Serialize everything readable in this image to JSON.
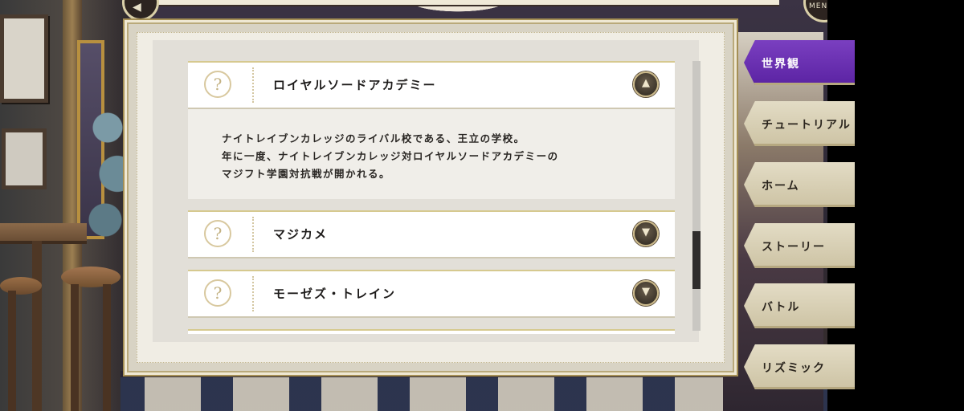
{
  "header": {
    "back_icon": "back-arrow-icon",
    "menu_label": "MENU"
  },
  "tabs": [
    {
      "label": "世界観",
      "active": true
    },
    {
      "label": "チュートリアル",
      "active": false
    },
    {
      "label": "ホーム",
      "active": false
    },
    {
      "label": "ストーリー",
      "active": false
    },
    {
      "label": "バトル",
      "active": false
    },
    {
      "label": "リズミック",
      "active": false
    }
  ],
  "glossary": {
    "items": [
      {
        "icon": "question-mark-icon",
        "title": "ロイヤルソードアカデミー",
        "expanded": true,
        "toggle_icon": "chevron-up-icon",
        "detail": [
          "ナイトレイブンカレッジのライバル校である、王立の学校。",
          "年に一度、ナイトレイブンカレッジ対ロイヤルソードアカデミーの",
          "マジフト学園対抗戦が開かれる。"
        ]
      },
      {
        "icon": "question-mark-icon",
        "title": "マジカメ",
        "expanded": false,
        "toggle_icon": "chevron-down-icon"
      },
      {
        "icon": "question-mark-icon",
        "title": "モーゼズ・トレイン",
        "expanded": false,
        "toggle_icon": "chevron-down-icon"
      },
      {
        "icon": "question-mark-icon",
        "title": "",
        "expanded": false,
        "toggle_icon": "chevron-down-icon"
      }
    ]
  },
  "colors": {
    "active_tab": "#6a2fb3",
    "tab": "#d8d0b5",
    "panel": "#f0ede4",
    "accent_gold": "#c9b27a"
  }
}
